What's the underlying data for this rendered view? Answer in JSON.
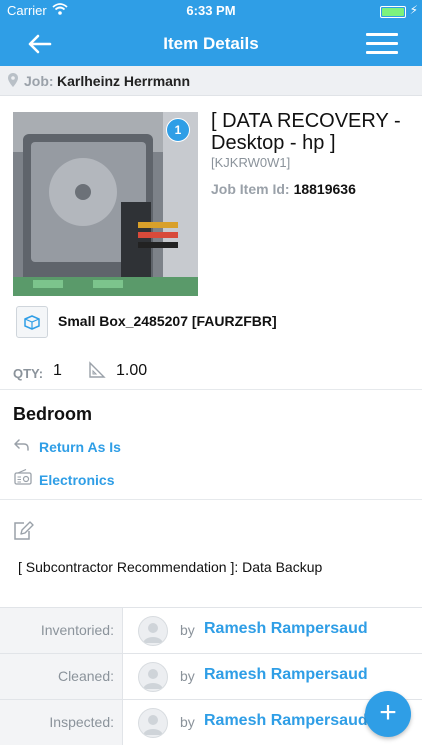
{
  "status_bar": {
    "carrier": "Carrier",
    "time": "6:33 PM"
  },
  "nav": {
    "title": "Item Details"
  },
  "job": {
    "label": "Job:",
    "name": "Karlheinz Herrmann"
  },
  "item": {
    "photo_count": "1",
    "title": "[ DATA RECOVERY - Desktop - hp ]",
    "sku": "[KJKRW0W1]",
    "job_item_label": "Job Item Id:",
    "job_item_id": "18819636",
    "box": "Small Box_2485207  [FAURZFBR]",
    "qty_label": "QTY:",
    "qty": "1",
    "area": "1.00"
  },
  "room": {
    "name": "Bedroom",
    "disposition": "Return As Is",
    "category": "Electronics"
  },
  "note": {
    "text": "[ Subcontractor Recommendation ]: Data Backup"
  },
  "status_rows": [
    {
      "label": "Inventoried:",
      "by": "by",
      "name": "Ramesh Rampersaud"
    },
    {
      "label": "Cleaned:",
      "by": "by",
      "name": "Ramesh Rampersaud"
    },
    {
      "label": "Inspected:",
      "by": "by",
      "name": "Ramesh Rampersaud"
    }
  ],
  "fab": {
    "label": "+"
  },
  "colors": {
    "accent": "#2f9ee6",
    "header": "#2f9ee6",
    "job_bar": "#eef0f3"
  }
}
